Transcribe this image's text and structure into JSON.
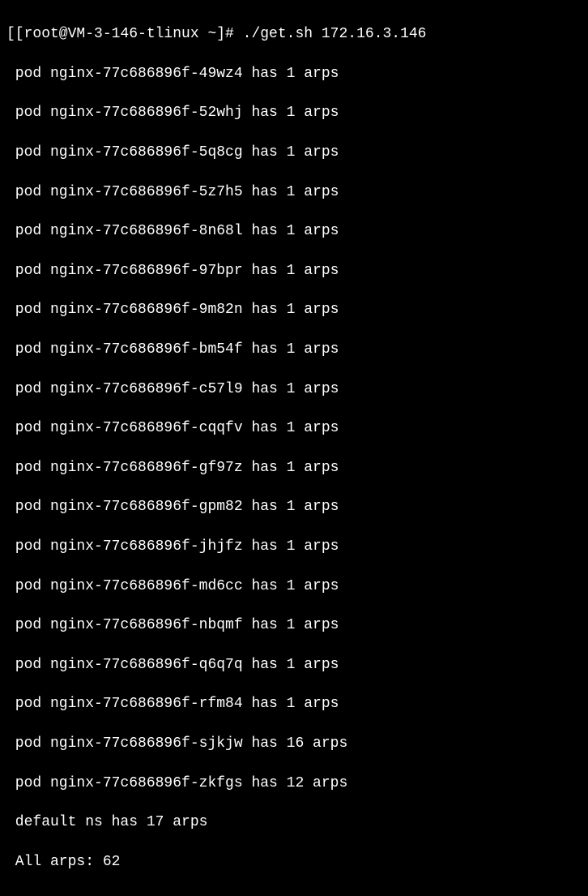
{
  "prompt": "[[root@VM-3-146-tlinux ~]# ./get.sh 172.16.3.146",
  "pods": [
    {
      "line": " pod nginx-77c686896f-49wz4 has 1 arps"
    },
    {
      "line": " pod nginx-77c686896f-52whj has 1 arps"
    },
    {
      "line": " pod nginx-77c686896f-5q8cg has 1 arps"
    },
    {
      "line": " pod nginx-77c686896f-5z7h5 has 1 arps"
    },
    {
      "line": " pod nginx-77c686896f-8n68l has 1 arps"
    },
    {
      "line": " pod nginx-77c686896f-97bpr has 1 arps"
    },
    {
      "line": " pod nginx-77c686896f-9m82n has 1 arps"
    },
    {
      "line": " pod nginx-77c686896f-bm54f has 1 arps"
    },
    {
      "line": " pod nginx-77c686896f-c57l9 has 1 arps"
    },
    {
      "line": " pod nginx-77c686896f-cqqfv has 1 arps"
    },
    {
      "line": " pod nginx-77c686896f-gf97z has 1 arps"
    },
    {
      "line": " pod nginx-77c686896f-gpm82 has 1 arps"
    },
    {
      "line": " pod nginx-77c686896f-jhjfz has 1 arps"
    },
    {
      "line": " pod nginx-77c686896f-md6cc has 1 arps"
    },
    {
      "line": " pod nginx-77c686896f-nbqmf has 1 arps"
    },
    {
      "line": " pod nginx-77c686896f-q6q7q has 1 arps"
    },
    {
      "line": " pod nginx-77c686896f-rfm84 has 1 arps"
    },
    {
      "line": " pod nginx-77c686896f-sjkjw has 16 arps"
    },
    {
      "line": " pod nginx-77c686896f-zkfgs has 12 arps"
    }
  ],
  "ns_summary": " default ns has 17 arps",
  "total": " All arps: 62"
}
